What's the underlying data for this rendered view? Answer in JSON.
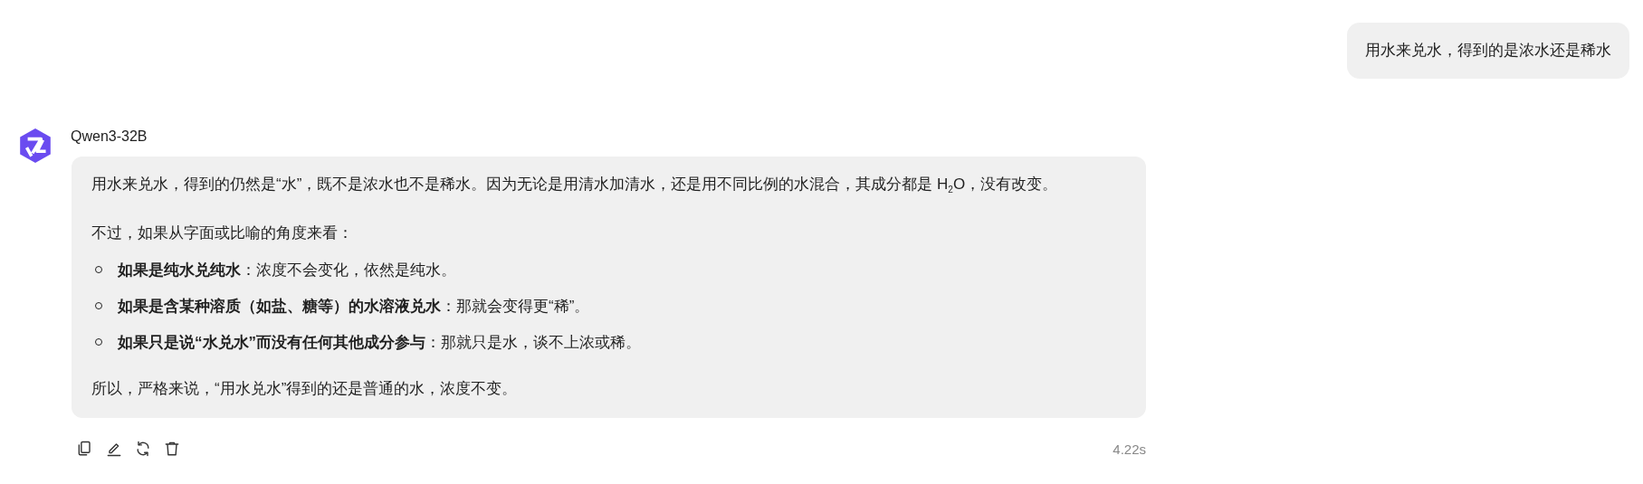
{
  "user_message": {
    "text": "用水来兑水，得到的是浓水还是稀水"
  },
  "reply": {
    "model": "Qwen3-32B",
    "blocks": [
      {
        "kind": "paragraph",
        "text": "用水来兑水，得到的仍然是“水”，既不是浓水也不是稀水。因为无论是用清水加清水，还是用不同比例的水混合，其成分都是 H$_{2}$O，没有改变。"
      },
      {
        "kind": "paragraph",
        "text": "不过，如果从字面或比喻的角度来看："
      },
      {
        "kind": "list",
        "items": [
          "**如果是纯水兑纯水**：浓度不会变化，依然是纯水。",
          "**如果是含某种溶质（如盐、糖等）的水溶液兑水**：那就会变得更“稀”。",
          "**如果只是说“水兑水”而没有任何其他成分参与**：那就只是水，谈不上浓或稀。"
        ]
      },
      {
        "kind": "paragraph",
        "text": "所以，严格来说，“用水兑水”得到的还是普通的水，浓度不变。"
      }
    ],
    "actions": [
      {
        "kind": "copy"
      },
      {
        "kind": "edit"
      },
      {
        "kind": "regenerate"
      },
      {
        "kind": "delete"
      }
    ],
    "time": "4.22s"
  }
}
